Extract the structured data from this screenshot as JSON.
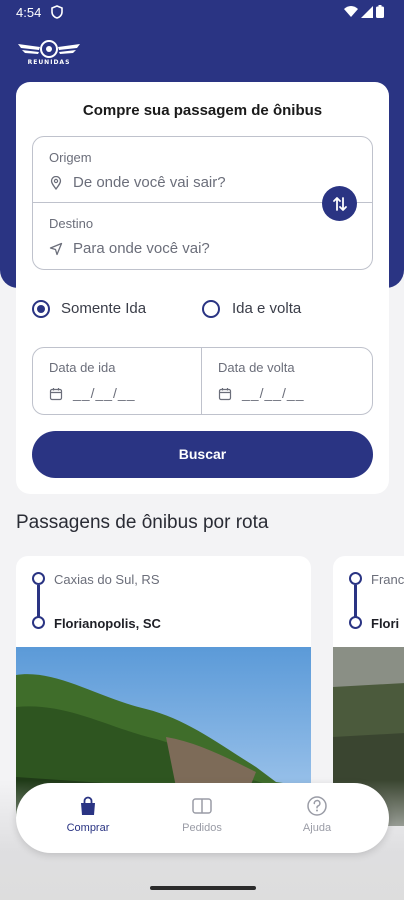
{
  "status_bar": {
    "time": "4:54"
  },
  "brand": {
    "logo_text": "REUNIDAS"
  },
  "search": {
    "title": "Compre sua passagem de ônibus",
    "origin_label": "Origem",
    "origin_placeholder": "De onde você vai sair?",
    "destination_label": "Destino",
    "destination_placeholder": "Para onde você vai?",
    "trip_options": [
      {
        "label": "Somente Ida",
        "selected": true
      },
      {
        "label": "Ida e volta",
        "selected": false
      }
    ],
    "departure_label": "Data de ida",
    "departure_value": "__/__/__",
    "return_label": "Data de volta",
    "return_value": "__/__/__",
    "submit_label": "Buscar"
  },
  "routes": {
    "section_title": "Passagens de ônibus por rota",
    "items": [
      {
        "from": "Caxias do Sul, RS",
        "to": "Florianopolis, SC"
      },
      {
        "from": "Franc",
        "to": "Flori"
      }
    ]
  },
  "nav": {
    "items": [
      {
        "label": "Comprar",
        "icon": "shopping-bag-icon",
        "active": true
      },
      {
        "label": "Pedidos",
        "icon": "ticket-icon",
        "active": false
      },
      {
        "label": "Ajuda",
        "icon": "help-icon",
        "active": false
      }
    ]
  },
  "colors": {
    "brand": "#2a3483",
    "background": "#f3f3f5",
    "card": "#ffffff"
  }
}
